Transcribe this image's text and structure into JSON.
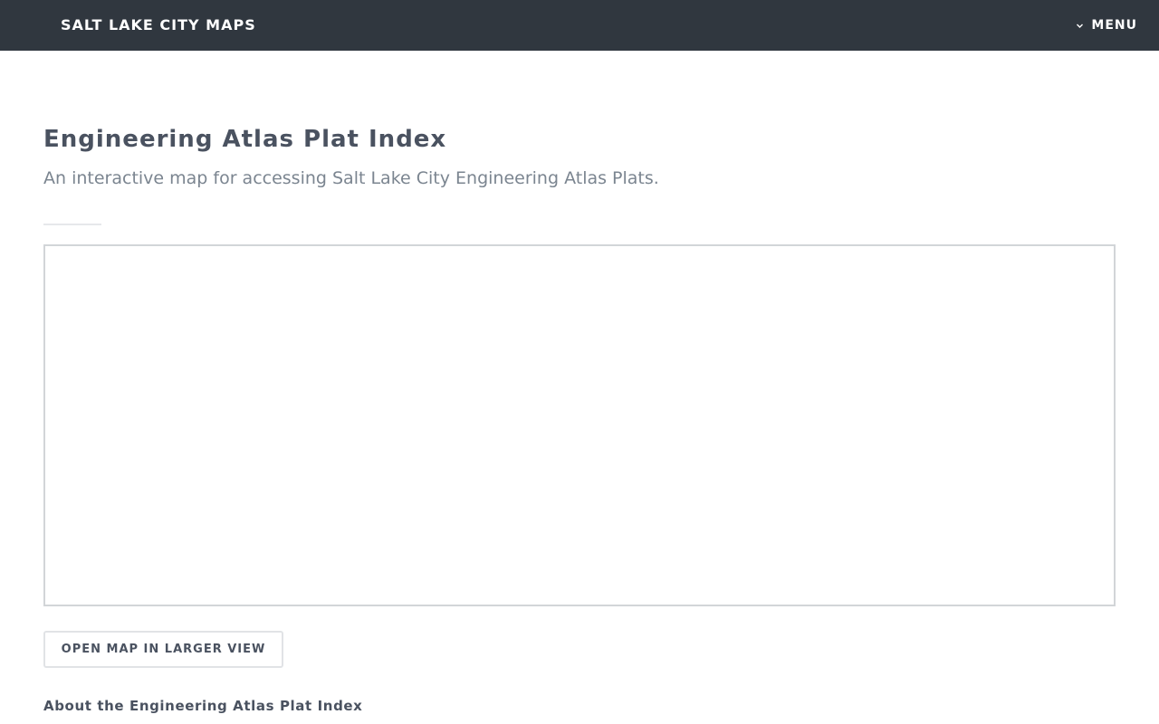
{
  "header": {
    "site_title": "SALT LAKE CITY MAPS",
    "menu_label": "MENU",
    "menu_icon": "chevron-down-icon"
  },
  "page": {
    "title": "Engineering Atlas Plat Index",
    "subtitle": "An interactive map for accessing Salt Lake City Engineering Atlas Plats."
  },
  "map": {
    "open_button_label": "OPEN MAP IN LARGER VIEW"
  },
  "about": {
    "heading": "About the Engineering Atlas Plat Index"
  },
  "colors": {
    "topbar": "#30373f",
    "title_text": "#4a5260",
    "subtitle_text": "#7b8590",
    "border": "#d2d5d8"
  }
}
